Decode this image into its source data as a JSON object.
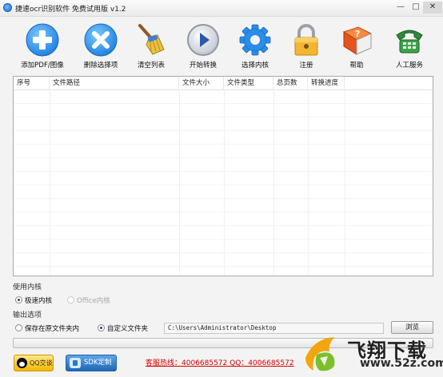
{
  "window": {
    "title": "捷速ocr识别软件 免费试用版 v1.2",
    "controls": {
      "minimize": "—",
      "maximize": "□",
      "close": "✕"
    }
  },
  "toolbar": {
    "items": [
      {
        "label": "添加PDF/图像",
        "icon": "add-icon"
      },
      {
        "label": "删除选择项",
        "icon": "delete-icon"
      },
      {
        "label": "清空列表",
        "icon": "broom-icon"
      },
      {
        "label": "开始转换",
        "icon": "play-icon"
      },
      {
        "label": "选择内核",
        "icon": "gear-icon"
      },
      {
        "label": "注册",
        "icon": "lock-icon"
      },
      {
        "label": "帮助",
        "icon": "help-book-icon"
      },
      {
        "label": "人工服务",
        "icon": "phone-icon"
      }
    ]
  },
  "table": {
    "columns": [
      "序号",
      "文件路径",
      "文件大小",
      "文件类型",
      "总页数",
      "转换进度"
    ],
    "rows": []
  },
  "engine": {
    "heading": "使用内核",
    "options": [
      {
        "label": "极速内核",
        "checked": true,
        "disabled": false
      },
      {
        "label": "Office内核",
        "checked": false,
        "disabled": true
      }
    ]
  },
  "output": {
    "heading": "输出选项",
    "options": [
      {
        "label": "保存在原文件夹内",
        "checked": false
      },
      {
        "label": "自定义文件夹",
        "checked": true
      }
    ],
    "path": "C:\\Users\\Administrator\\Desktop",
    "browse_label": "浏览"
  },
  "progress": {
    "value": 0
  },
  "footer": {
    "qq_label": "QQ交谈",
    "sdk_label": "SDK定制",
    "hotline": "客服热线：4006685572 QQ：4006685572"
  },
  "watermark": {
    "text": "飞翔下载",
    "url": "www.52z.com"
  },
  "colors": {
    "accent_blue": "#2a8ee8",
    "hotline_red": "#d40000",
    "qq_yellow": "#f4b800"
  }
}
